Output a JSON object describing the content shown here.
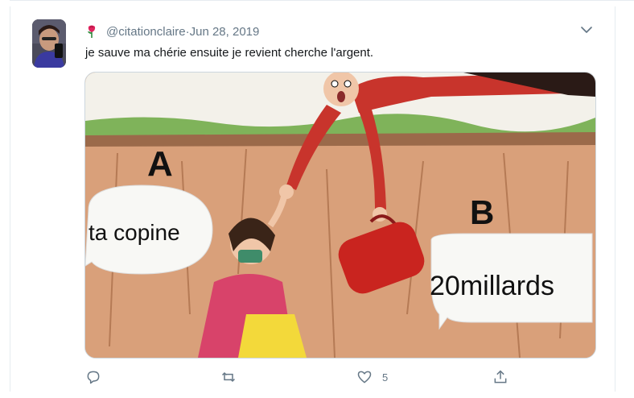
{
  "tweet": {
    "handle": "@citationclaire",
    "separator": " · ",
    "date": "Jun 28, 2019",
    "text": "je sauve ma chérie ensuite je revient cherche l'argent."
  },
  "meme": {
    "label_a": "A",
    "label_b": "B",
    "bubble_a": "ta copine",
    "bubble_b": "20millards"
  },
  "actions": {
    "like_count": "5"
  },
  "icons": {
    "avatar": "avatar-photo",
    "badge": "rose-flower-icon",
    "menu": "chevron-down-icon",
    "reply": "reply-icon",
    "retweet": "retweet-icon",
    "like": "heart-icon",
    "share": "share-icon"
  },
  "colors": {
    "meta_gray": "#657786",
    "text": "#14171a",
    "border": "#e6ecf0"
  }
}
